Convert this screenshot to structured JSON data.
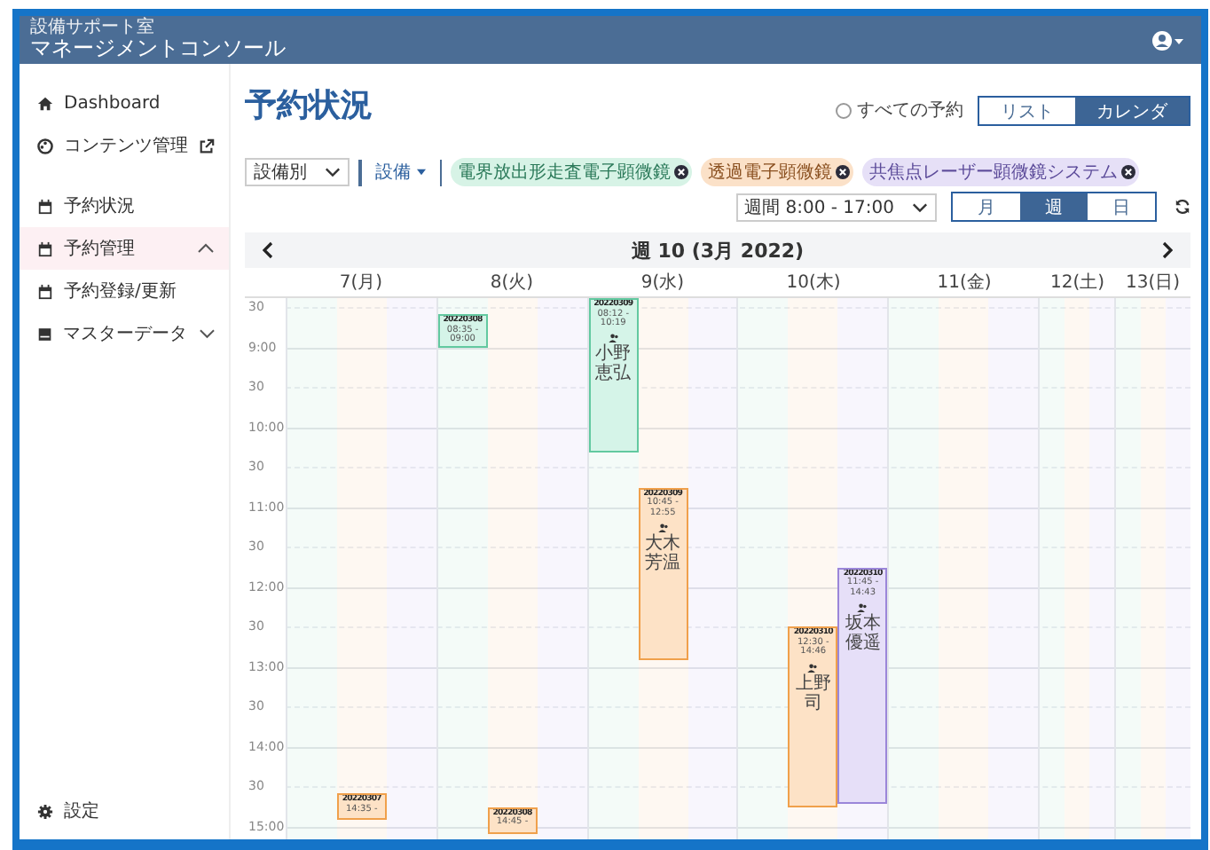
{
  "header": {
    "subtitle": "設備サポート室",
    "title": "マネージメントコンソール"
  },
  "sidebar": {
    "items": [
      {
        "kind": "home",
        "label": "Dashboard",
        "selected": false
      },
      {
        "kind": "palette",
        "label": "コンテンツ管理",
        "selected": false,
        "external": true
      },
      {
        "kind": "calendar",
        "label": "予約状況",
        "selected": false
      },
      {
        "kind": "calendar",
        "label": "予約管理",
        "selected": true,
        "expanded": true,
        "children": [
          {
            "kind": "calendar",
            "label": "予約登録/更新",
            "selected": false
          }
        ]
      },
      {
        "kind": "book",
        "label": "マスターデータ",
        "selected": false,
        "expanded": false
      }
    ],
    "footer": {
      "kind": "gear",
      "label": "設定"
    }
  },
  "page": {
    "title": "予約状況",
    "all_reservations": {
      "label": "すべての予約",
      "checked": false
    },
    "view_toggle": [
      {
        "label": "リスト",
        "selected": false
      },
      {
        "label": "カレンダ",
        "selected": true
      }
    ],
    "group_select": "設備別",
    "equipment_button": "設備",
    "chips": [
      {
        "kind": "sem",
        "label": "電界放出形走査電子顕微鏡"
      },
      {
        "kind": "tem",
        "label": "透過電子顕微鏡"
      },
      {
        "kind": "confocal",
        "label": "共焦点レーザー顕微鏡システム"
      }
    ],
    "range_select": "週間 8:00 - 17:00",
    "period_tabs": [
      {
        "label": "月",
        "selected": false
      },
      {
        "label": "週",
        "selected": true
      },
      {
        "label": "日",
        "selected": false
      }
    ]
  },
  "calendar": {
    "title": "週 10 (3月 2022)",
    "time_labels": [
      "30",
      "9:00",
      "30",
      "10:00",
      "30",
      "11:00",
      "30",
      "12:00",
      "30",
      "13:00",
      "30",
      "14:00",
      "30",
      "15:00"
    ],
    "days": [
      {
        "label": "7(月)",
        "weekend": false,
        "events": [
          {
            "kind": "tem",
            "id": "20220307",
            "start": "14:35 -"
          }
        ]
      },
      {
        "label": "8(火)",
        "weekend": false,
        "events": [
          {
            "kind": "sem",
            "id": "20220308",
            "start": "08:35 -",
            "end": "09:00"
          },
          {
            "kind": "tem",
            "id": "20220308",
            "start": "14:45 -"
          }
        ]
      },
      {
        "label": "9(水)",
        "weekend": false,
        "events": [
          {
            "kind": "sem",
            "id": "20220309",
            "start": "08:12 -",
            "end": "10:19",
            "person": "小野恵弘"
          },
          {
            "kind": "tem",
            "id": "20220309",
            "start": "10:45 -",
            "end": "12:55",
            "person": "大木芳温"
          }
        ]
      },
      {
        "label": "10(木)",
        "weekend": false,
        "events": [
          {
            "kind": "tem",
            "id": "20220310",
            "start": "12:30 -",
            "end": "14:46",
            "person": "上野司"
          },
          {
            "kind": "confocal",
            "id": "20220310",
            "start": "11:45 -",
            "end": "14:43",
            "person": "坂本優遥"
          }
        ]
      },
      {
        "label": "11(金)",
        "weekend": false
      },
      {
        "label": "12(土)",
        "weekend": true
      },
      {
        "label": "13(日)",
        "weekend": true
      }
    ]
  }
}
